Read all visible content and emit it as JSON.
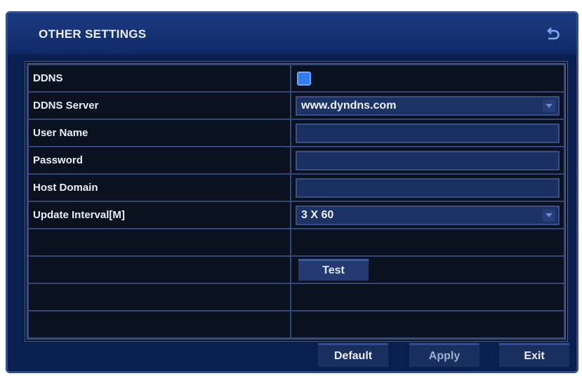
{
  "window": {
    "title": "OTHER SETTINGS"
  },
  "rows": [
    {
      "label": "DDNS",
      "type": "checkbox",
      "checked": true
    },
    {
      "label": "DDNS Server",
      "type": "select",
      "value": "www.dyndns.com"
    },
    {
      "label": "User Name",
      "type": "text",
      "value": ""
    },
    {
      "label": "Password",
      "type": "text",
      "value": ""
    },
    {
      "label": "Host Domain",
      "type": "text",
      "value": ""
    },
    {
      "label": "Update Interval[M]",
      "type": "select",
      "value": "3 X 60"
    }
  ],
  "test_button": {
    "label": "Test"
  },
  "buttons": {
    "default": "Default",
    "apply": "Apply",
    "exit": "Exit"
  },
  "colors": {
    "background": "#0a1f4f",
    "checkbox": "#2f7cf0",
    "border": "#34477a"
  },
  "icons": {
    "back": "back-arrow-icon"
  }
}
